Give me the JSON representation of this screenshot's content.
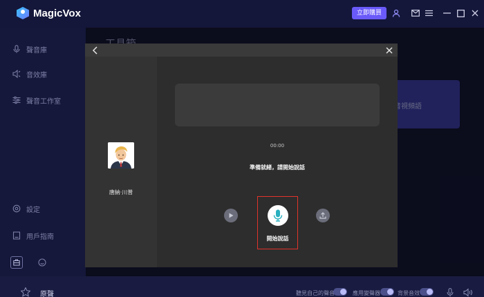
{
  "app": {
    "title": "MagicVox",
    "buy_button": "立即購買"
  },
  "sidebar": {
    "items": [
      {
        "label": "聲音庫",
        "icon": "mic-icon"
      },
      {
        "label": "音效庫",
        "icon": "sound-effect-icon"
      },
      {
        "label": "聲音工作室",
        "icon": "sliders-icon"
      },
      {
        "label": "設定",
        "icon": "settings-icon"
      },
      {
        "label": "用戶指南",
        "icon": "guide-icon"
      }
    ]
  },
  "background": {
    "page_title": "工具箱",
    "card_label": "音視頻語"
  },
  "modal": {
    "voice_name": "唐納·川普",
    "timer": "00:00",
    "ready_text": "準備就緒，請開始說話",
    "record_label": "開始說話"
  },
  "footer": {
    "current_voice": "原聲",
    "toggle_1_label": "聽見自己的聲音",
    "toggle_2_label": "應用變聲器",
    "toggle_3_label": "背景音效"
  },
  "colors": {
    "accent": "#6a5af9",
    "highlight_border": "#e3332b",
    "mic_icon": "#2ab0bf"
  }
}
